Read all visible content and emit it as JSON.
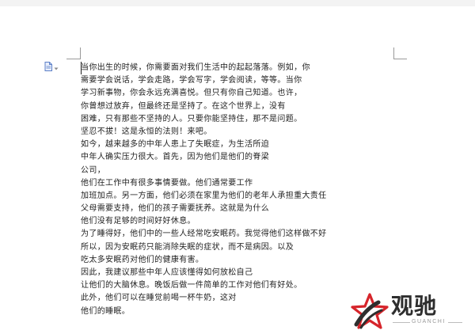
{
  "document": {
    "lines": [
      "当你出生的时候，你需要面对我们生活中的起起落落。例如，你",
      "需要学会说话，学会走路，学会写字，学会阅读，等等。当你",
      "学习新事物，你会永远充满喜悦。但只有你自己知道。也许，",
      "你曾想过放弃，但最终还是坚持了。在这个世界上，没有",
      "困难，只有那些不坚持的人。只要你能坚持住，那不是问题。",
      "坚忍不拔！这是永恒的法则！来吧。",
      "如今，越来越多的中年人患上了失眠症，为生活所迫",
      "中年人确实压力很大。首先，因为他们是他们的脊梁",
      "公司，",
      "他们在工作中有很多事情要做。他们通常要工作",
      "加班加点。另一方面，他们必须在家里为他们的老年人承担重大责任",
      "父母需要支持，他们的孩子需要抚养。这就是为什么",
      "他们没有足够的时间好好休息。",
      "为了睡得好，他们中的一些人经常吃安眠药。我觉得他们这样做不好",
      "所以，因为安眠药只能消除失眠的症状，而不是病因。以及",
      "吃太多安眠药对他们的健康有害。",
      "因此，我建议那些中年人应该懂得如何放松自己",
      "让他们的大脑休息。晚饭后做一件简单的工作对他们有好处。",
      "此外，他们可以在睡觉前喝一杯牛奶，这对",
      "他们的睡眠。"
    ]
  },
  "watermark": {
    "title": "观驰",
    "subtitle": "GUANCHI",
    "colors": {
      "red": "#d6252b",
      "dark": "#2e2e2e"
    }
  },
  "icons": {
    "paragraph_marker": "document-options-icon"
  }
}
